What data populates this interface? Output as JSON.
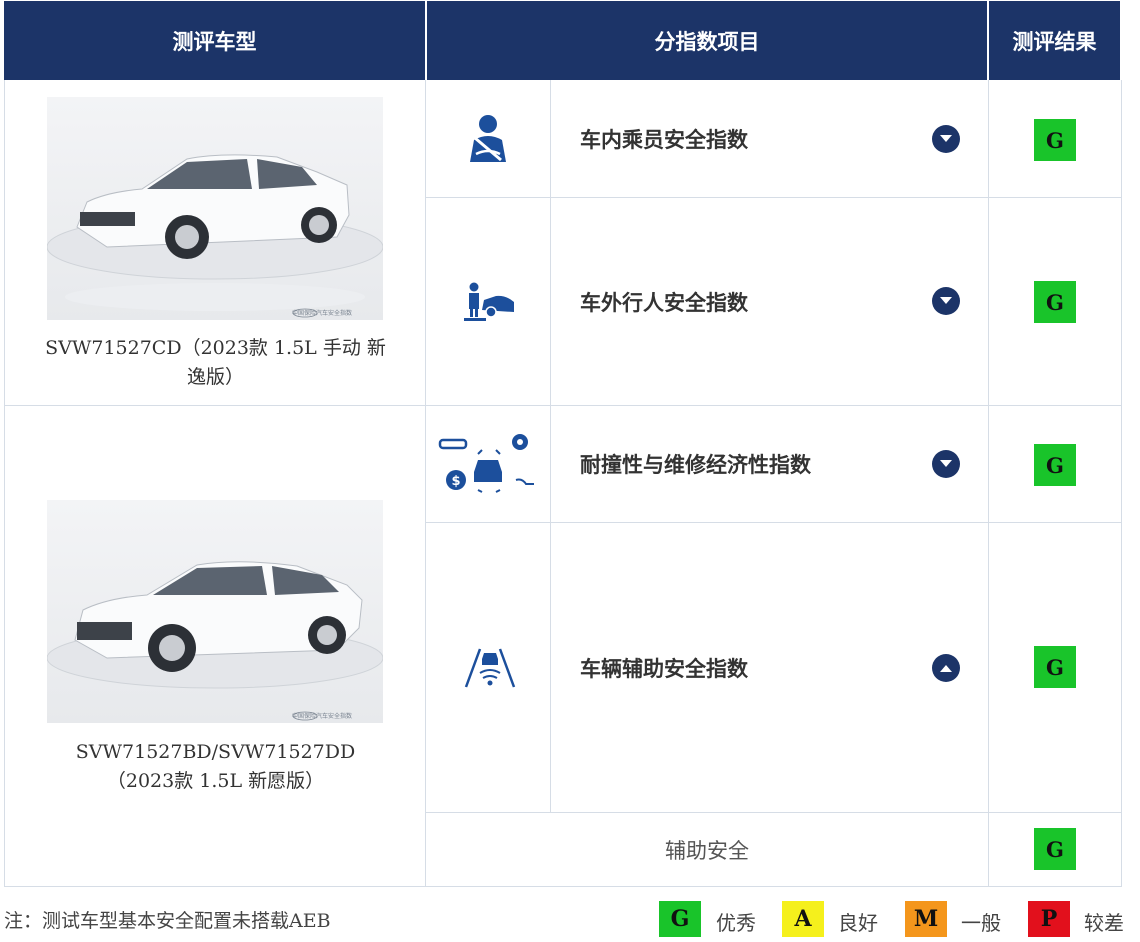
{
  "header": {
    "col_model": "测评车型",
    "col_index": "分指数项目",
    "col_result": "测评结果"
  },
  "vehicles": [
    {
      "caption": "SVW71527CD（2023款 1.5L 手动 新逸版）",
      "watermark": "中国保险汽车安全指数"
    },
    {
      "caption": "SVW71527BD/SVW71527DD（2023款 1.5L 新愿版）",
      "watermark": "中国保险汽车安全指数"
    }
  ],
  "indices": [
    {
      "label": "车内乘员安全指数",
      "icon": "occupant-seatbelt-icon",
      "expanded": false,
      "result": "G"
    },
    {
      "label": "车外行人安全指数",
      "icon": "pedestrian-car-icon",
      "expanded": false,
      "result": "G"
    },
    {
      "label": "耐撞性与维修经济性指数",
      "icon": "repair-cost-icon",
      "expanded": false,
      "result": "G"
    },
    {
      "label": "车辆辅助安全指数",
      "icon": "assist-lane-icon",
      "expanded": true,
      "result": "G"
    }
  ],
  "sub_row": {
    "label": "辅助安全",
    "result": "G"
  },
  "note": "注：测试车型基本安全配置未搭载AEB",
  "legend": [
    {
      "code": "G",
      "text": "优秀",
      "color": "#19c42a"
    },
    {
      "code": "A",
      "text": "良好",
      "color": "#f5f01c"
    },
    {
      "code": "M",
      "text": "一般",
      "color": "#f4961c"
    },
    {
      "code": "P",
      "text": "较差",
      "color": "#e2101c"
    }
  ],
  "colors": {
    "header_bg": "#1c3468",
    "grid": "#d6dde6",
    "good": "#19c42a"
  }
}
